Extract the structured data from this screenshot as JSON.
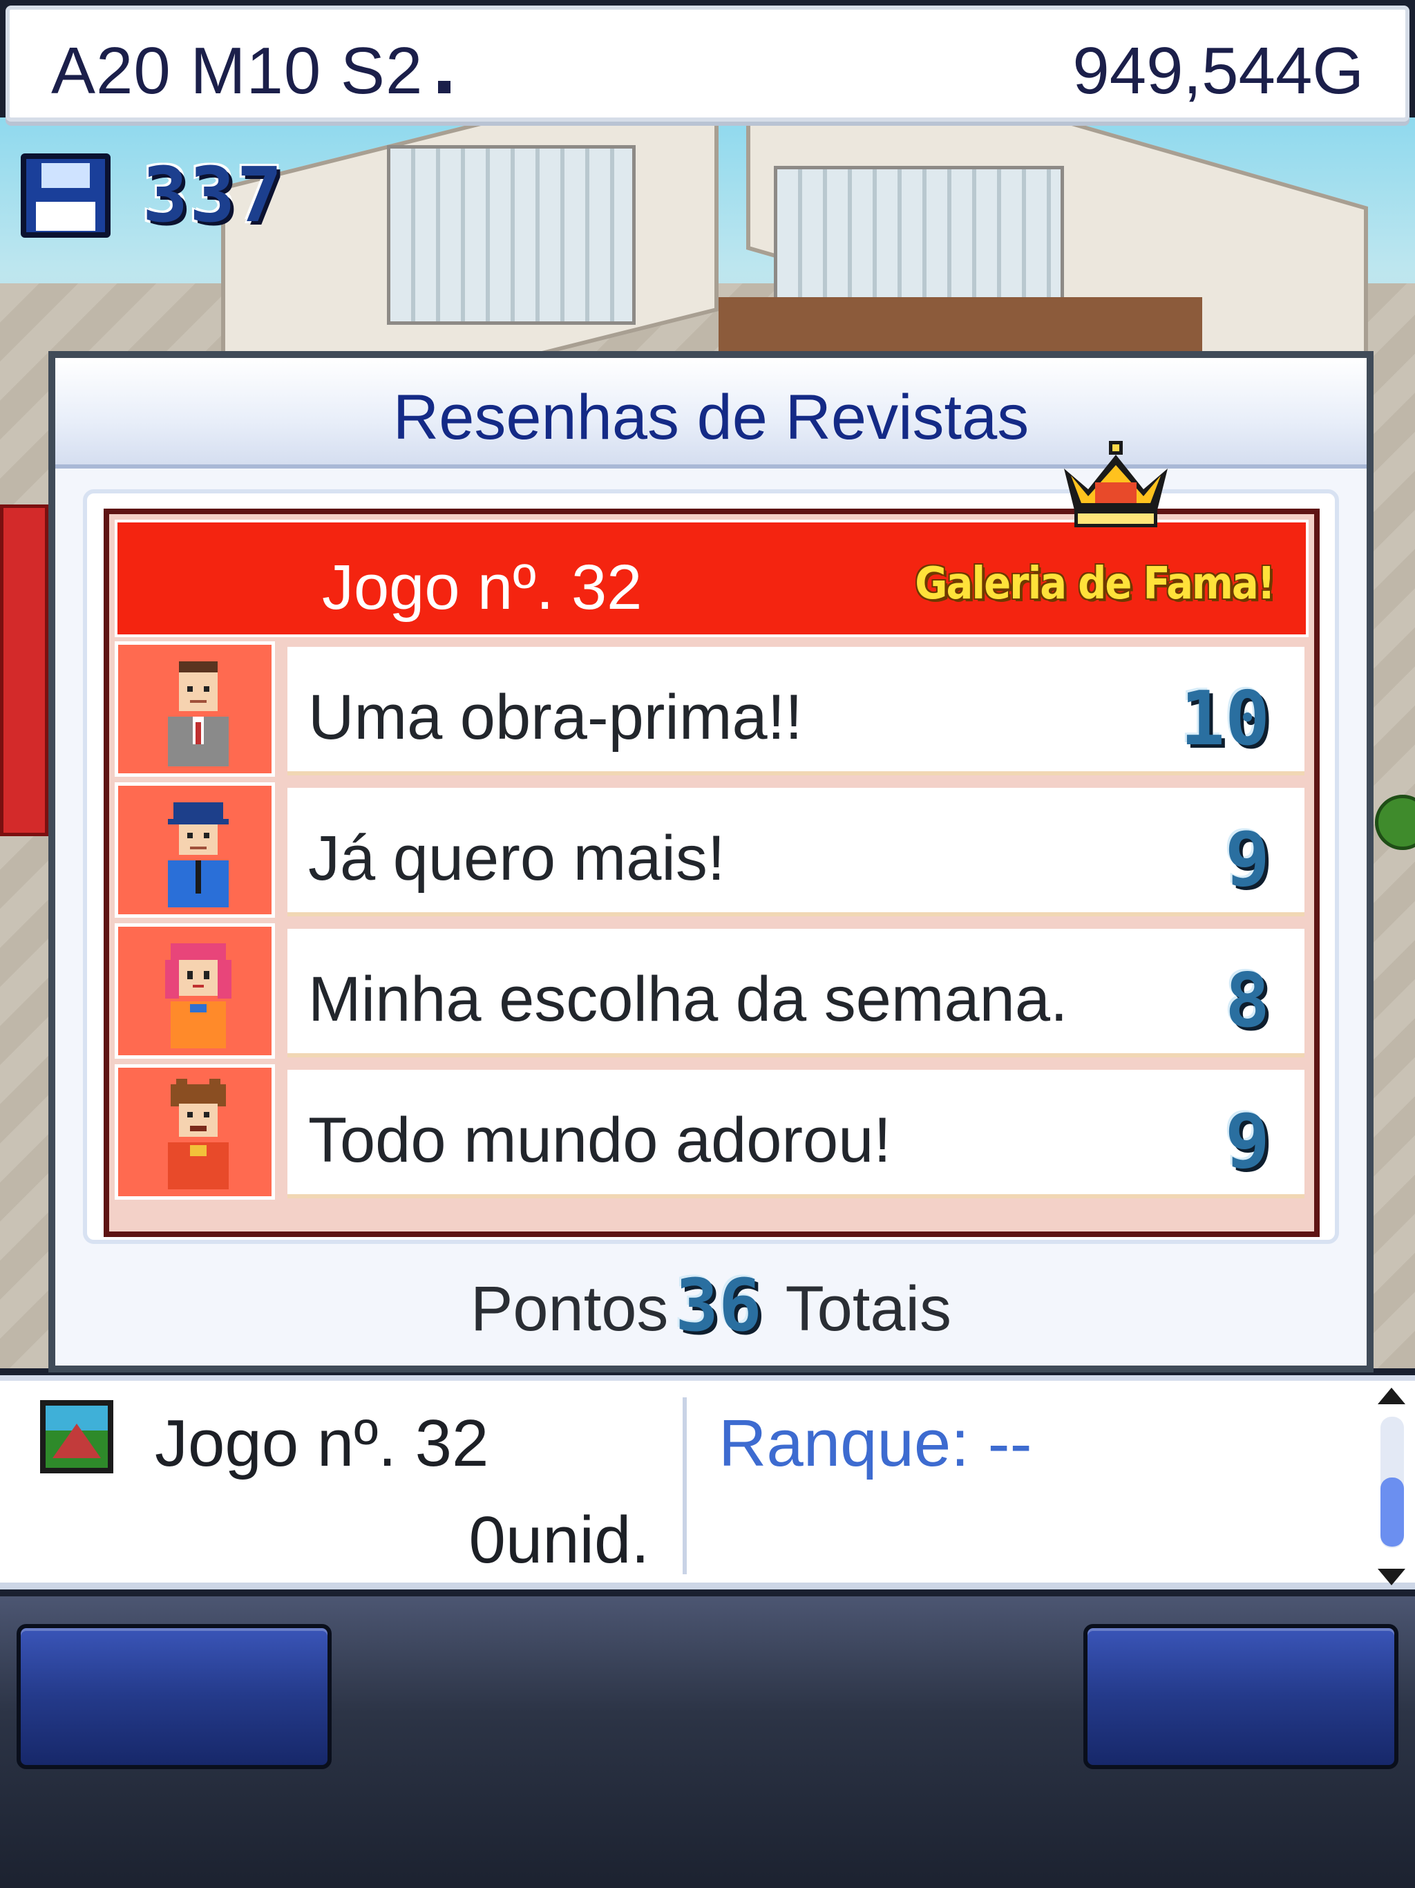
{
  "status": {
    "date": "A20 M10 S2",
    "money": "949,544G"
  },
  "save_counter": {
    "icon": "floppy-disk-icon",
    "value": "337"
  },
  "dialog": {
    "title": "Resenhas de Revistas",
    "game_name": "Jogo nº. 32",
    "hall_of_fame": "Galeria de Fama!",
    "crown_icon": "crown-icon",
    "reviews": [
      {
        "reviewer": "reviewer-1",
        "comment": "Uma obra-prima!!",
        "score": "10"
      },
      {
        "reviewer": "reviewer-2",
        "comment": "Já quero mais!",
        "score": "9"
      },
      {
        "reviewer": "reviewer-3",
        "comment": "Minha escolha da semana.",
        "score": "8"
      },
      {
        "reviewer": "reviewer-4",
        "comment": "Todo mundo adorou!",
        "score": "9"
      }
    ],
    "total_prefix": "Pontos",
    "total_points": "36",
    "total_suffix": "Totais"
  },
  "info_panel": {
    "game_name": "Jogo nº. 32",
    "units": "0unid.",
    "rank": "Ranque: --"
  },
  "colors": {
    "header_red": "#f42410",
    "portrait_bg": "#ff6a50",
    "score_blue": "#2a6fa0",
    "title_navy": "#142a86",
    "rank_blue": "#3d6bd0"
  }
}
